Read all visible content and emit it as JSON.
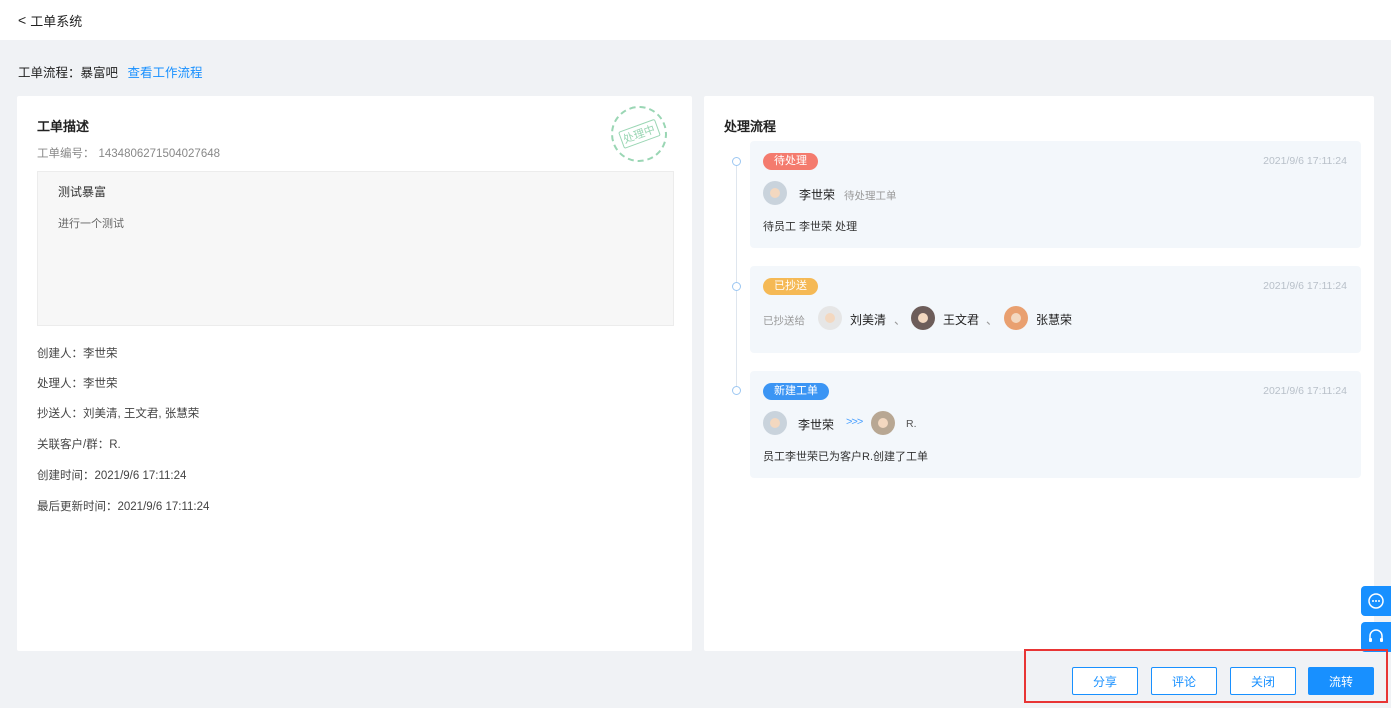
{
  "header": {
    "back_icon": "chevron-left-icon",
    "title": "工单系统"
  },
  "flow": {
    "label": "工单流程：",
    "name": "暴富吧",
    "link": "查看工作流程"
  },
  "description": {
    "title": "工单描述",
    "stamp_text": "处理中",
    "ticket_no_label": "工单编号：",
    "ticket_no": "1434806271504027648",
    "content_title": "测试暴富",
    "content_body": "进行一个测试",
    "fields": [
      {
        "label": "创建人：",
        "value": "李世荣"
      },
      {
        "label": "处理人：",
        "value": "李世荣"
      },
      {
        "label": "抄送人：",
        "value": "刘美清, 王文君, 张慧荣"
      },
      {
        "label": "关联客户/群：",
        "value": "R."
      },
      {
        "label": "创建时间：",
        "value": "2021/9/6 17:11:24"
      },
      {
        "label": "最后更新时间：",
        "value": "2021/9/6 17:11:24"
      }
    ]
  },
  "process": {
    "title": "处理流程",
    "steps": [
      {
        "badge": "待处理",
        "badge_color": "#f47b6e",
        "time": "2021/9/6 17:11:24",
        "user": "李世荣",
        "user_sub": "待处理工单",
        "note": "待员工 李世荣 处理"
      },
      {
        "badge": "已抄送",
        "badge_color": "#f5b955",
        "time": "2021/9/6 17:11:24",
        "prefix": "已抄送给",
        "sep": "、",
        "people": [
          "刘美清",
          "王文君",
          "张慧荣"
        ]
      },
      {
        "badge": "新建工单",
        "badge_color": "#3b95f4",
        "time": "2021/9/6 17:11:24",
        "from_user": "李世荣",
        "arrows": ">>>",
        "to_user": "R.",
        "note": "员工李世荣已为客户R.创建了工单"
      }
    ]
  },
  "floating": {
    "chat_icon": "chat-bubble-icon",
    "support_icon": "headset-icon"
  },
  "actions": {
    "share": "分享",
    "comment": "评论",
    "close": "关闭",
    "transfer": "流转"
  }
}
